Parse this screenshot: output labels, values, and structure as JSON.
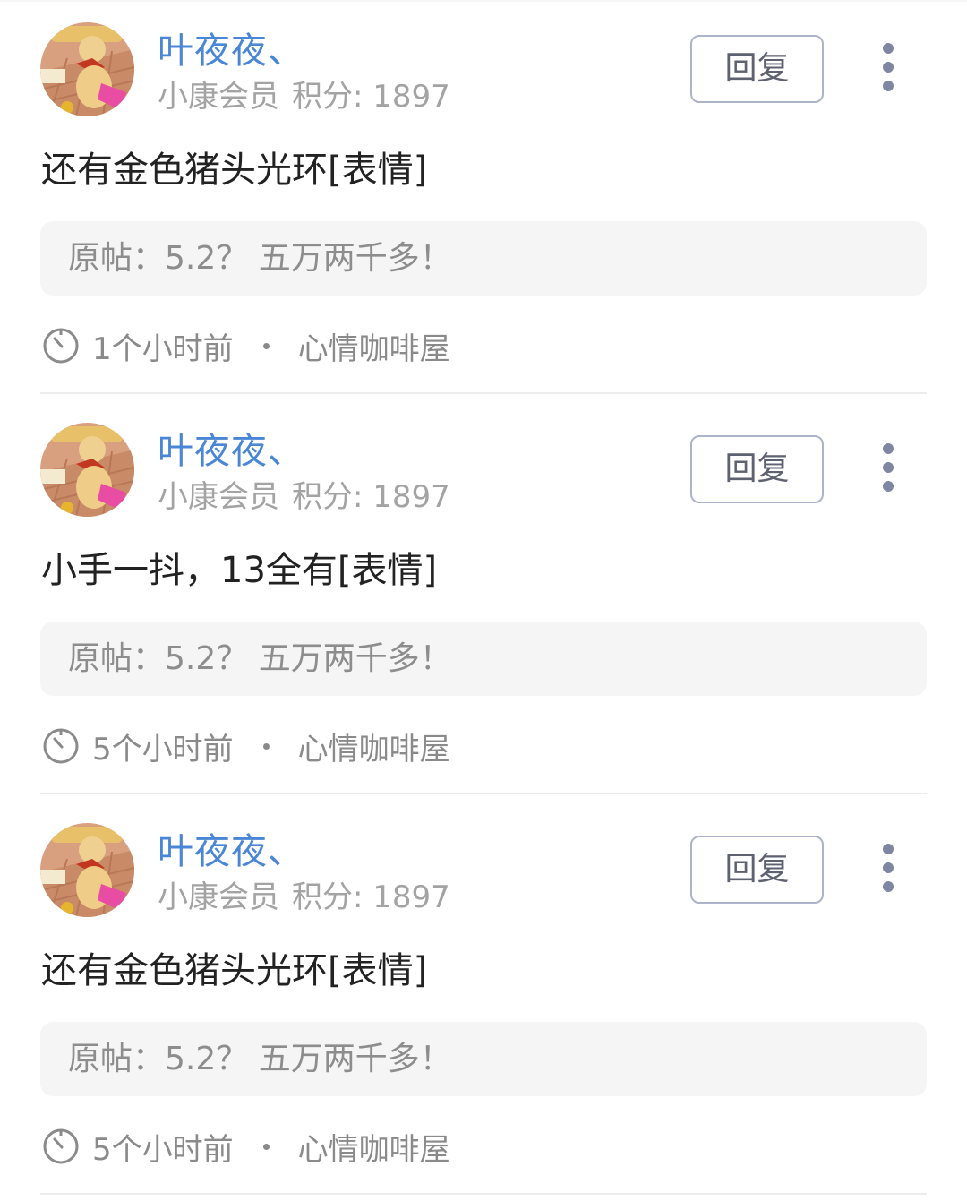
{
  "feed": {
    "items": [
      {
        "username": "叶夜夜、",
        "rank": "小康会员",
        "points_label": "积分:",
        "points_value": "1897",
        "reply_label": "回复",
        "content": "还有金色猪头光环[表情]",
        "quote": "原帖：5.2？ 五万两千多！",
        "time": "1个小时前",
        "forum": "心情咖啡屋"
      },
      {
        "username": "叶夜夜、",
        "rank": "小康会员",
        "points_label": "积分:",
        "points_value": "1897",
        "reply_label": "回复",
        "content": "小手一抖，13全有[表情]",
        "quote": "原帖：5.2？ 五万两千多！",
        "time": "5个小时前",
        "forum": "心情咖啡屋"
      },
      {
        "username": "叶夜夜、",
        "rank": "小康会员",
        "points_label": "积分:",
        "points_value": "1897",
        "reply_label": "回复",
        "content": "还有金色猪头光环[表情]",
        "quote": "原帖：5.2？ 五万两千多！",
        "time": "5个小时前",
        "forum": "心情咖啡屋"
      }
    ]
  },
  "colors": {
    "username": "#4a86d6",
    "meta_text": "#a3a3a3",
    "content_text": "#222222",
    "quote_bg": "#f5f5f5",
    "quote_text": "#8d8d8d",
    "reply_border": "#adb3c9",
    "more_dots": "#7e86a1",
    "divider": "#ececec"
  },
  "icons": {
    "avatar": "avatar-image",
    "reply": "reply-button",
    "more": "more-vertical-icon",
    "time": "clock-icon"
  }
}
